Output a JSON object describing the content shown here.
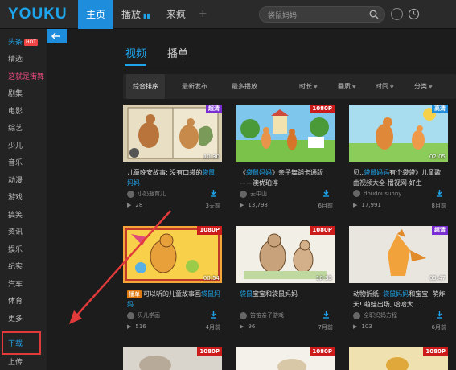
{
  "topbar": {
    "logo": "YOUKU",
    "nav": [
      {
        "label": "主页",
        "active": true
      },
      {
        "label": "播放",
        "active": false
      },
      {
        "label": "来疯",
        "active": false
      }
    ],
    "plus": "+",
    "search_value": "袋鼠妈妈"
  },
  "sidebar": {
    "items": [
      {
        "label": "头条",
        "style": "blue",
        "badge": "HOT"
      },
      {
        "label": "精选",
        "style": ""
      },
      {
        "label": "这就是街舞",
        "style": "pink"
      },
      {
        "label": "剧集",
        "style": ""
      },
      {
        "label": "电影",
        "style": ""
      },
      {
        "label": "综艺",
        "style": ""
      },
      {
        "label": "少儿",
        "style": ""
      },
      {
        "label": "音乐",
        "style": ""
      },
      {
        "label": "动漫",
        "style": ""
      },
      {
        "label": "游戏",
        "style": ""
      },
      {
        "label": "搞笑",
        "style": ""
      },
      {
        "label": "资讯",
        "style": ""
      },
      {
        "label": "娱乐",
        "style": ""
      },
      {
        "label": "纪实",
        "style": ""
      },
      {
        "label": "汽车",
        "style": ""
      },
      {
        "label": "体育",
        "style": ""
      },
      {
        "label": "更多",
        "style": ""
      },
      {
        "label": "下载",
        "style": "blue"
      },
      {
        "label": "上传",
        "style": ""
      }
    ]
  },
  "main": {
    "tabs": [
      {
        "label": "视频",
        "active": true
      },
      {
        "label": "播单",
        "active": false
      }
    ],
    "filters": [
      {
        "label": "综合排序",
        "active": true
      },
      {
        "label": "最新发布",
        "active": false
      },
      {
        "label": "最多播放",
        "active": false
      },
      {
        "label": "时长",
        "active": false
      },
      {
        "label": "画质",
        "active": false
      },
      {
        "label": "时间",
        "active": false
      },
      {
        "label": "分类",
        "active": false
      }
    ],
    "cards": [
      {
        "badge": "超清",
        "badge_color": "purple",
        "duration": "10:30",
        "title_pre": "儿童晚安故事: 没有口袋的",
        "title_hl": "袋鼠妈妈",
        "title_post": "",
        "type_tag": "",
        "uploader": "小奶瓶育儿",
        "plays": "28",
        "time": "3天前"
      },
      {
        "badge": "1080P",
        "badge_color": "red",
        "duration": "",
        "title_pre": "《",
        "title_hl": "袋鼠妈妈",
        "title_post": "》亲子舞蹈卡通版——澳优珀淳",
        "type_tag": "",
        "uploader": "云中山",
        "plays": "13,798",
        "time": "6月前"
      },
      {
        "badge": "高清",
        "badge_color": "blue",
        "duration": "02:05",
        "title_pre": "贝..",
        "title_hl": "袋鼠妈妈",
        "title_post": "有个袋袋》儿童歌曲视频大全-播视网-好生",
        "type_tag": "",
        "uploader": "doudousunny",
        "plays": "17,991",
        "time": "8月前"
      },
      {
        "badge": "1080P",
        "badge_color": "red",
        "duration": "00:54",
        "title_pre": "可以听的儿童故事画",
        "title_hl": "袋鼠妈妈",
        "title_post": "",
        "type_tag": "播单",
        "uploader": "贝儿学画",
        "plays": "516",
        "time": "4月前"
      },
      {
        "badge": "1080P",
        "badge_color": "red",
        "duration": "10:35",
        "title_pre": "",
        "title_hl": "袋鼠",
        "title_post": "宝宝和袋鼠妈妈",
        "type_tag": "",
        "uploader": "笛笛亲子游戏",
        "plays": "96",
        "time": "7月前"
      },
      {
        "badge": "超清",
        "badge_color": "purple",
        "duration": "05:47",
        "title_pre": "动物折纸: ",
        "title_hl": "袋鼠妈妈",
        "title_post": "和宝宝, 萌炸天! 萌娃出场, 哈哈大...",
        "type_tag": "",
        "uploader": "全职妈妈方程",
        "plays": "103",
        "time": "6月前"
      }
    ],
    "bottom_badges": [
      {
        "badge": "1080P",
        "badge_color": "red"
      },
      {
        "badge": "1080P",
        "badge_color": "red"
      },
      {
        "badge": "1080P",
        "badge_color": "red"
      }
    ]
  }
}
